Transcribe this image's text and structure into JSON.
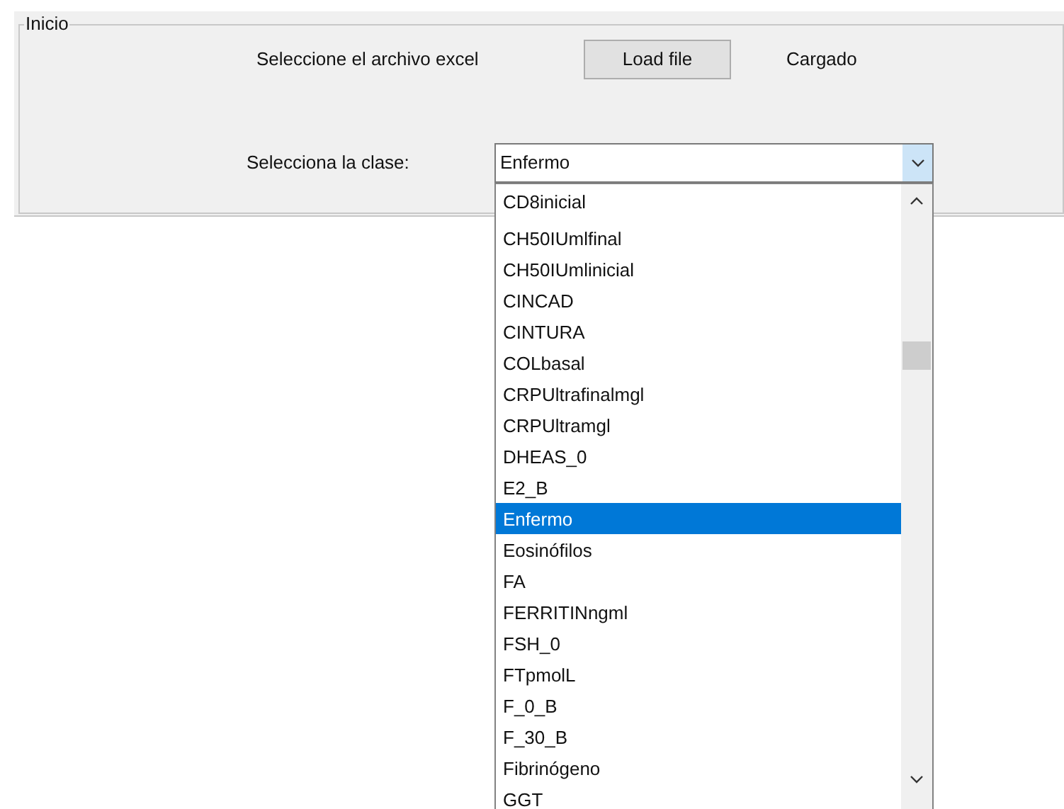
{
  "group": {
    "title": "Inicio"
  },
  "file_label": "Seleccione el archivo excel",
  "load_button": "Load file",
  "status": "Cargado",
  "class_label": "Selecciona la clase:",
  "class_select": {
    "value": "Enfermo",
    "expanded": true
  },
  "options": [
    {
      "label": "CD8inicial",
      "selected": false
    },
    {
      "label": "CH50IUmlfinal",
      "selected": false
    },
    {
      "label": "CH50IUmlinicial",
      "selected": false
    },
    {
      "label": "CINCAD",
      "selected": false
    },
    {
      "label": "CINTURA",
      "selected": false
    },
    {
      "label": "COLbasal",
      "selected": false
    },
    {
      "label": "CRPUltrafinalmgl",
      "selected": false
    },
    {
      "label": "CRPUltramgl",
      "selected": false
    },
    {
      "label": "DHEAS_0",
      "selected": false
    },
    {
      "label": "E2_B",
      "selected": false
    },
    {
      "label": "Enfermo",
      "selected": true
    },
    {
      "label": "Eosinófilos",
      "selected": false
    },
    {
      "label": "FA",
      "selected": false
    },
    {
      "label": "FERRITINngml",
      "selected": false
    },
    {
      "label": "FSH_0",
      "selected": false
    },
    {
      "label": "FTpmolL",
      "selected": false
    },
    {
      "label": "F_0_B",
      "selected": false
    },
    {
      "label": "F_30_B",
      "selected": false
    },
    {
      "label": "Fibrinógeno",
      "selected": false
    },
    {
      "label": "GGT",
      "selected": false
    }
  ]
}
